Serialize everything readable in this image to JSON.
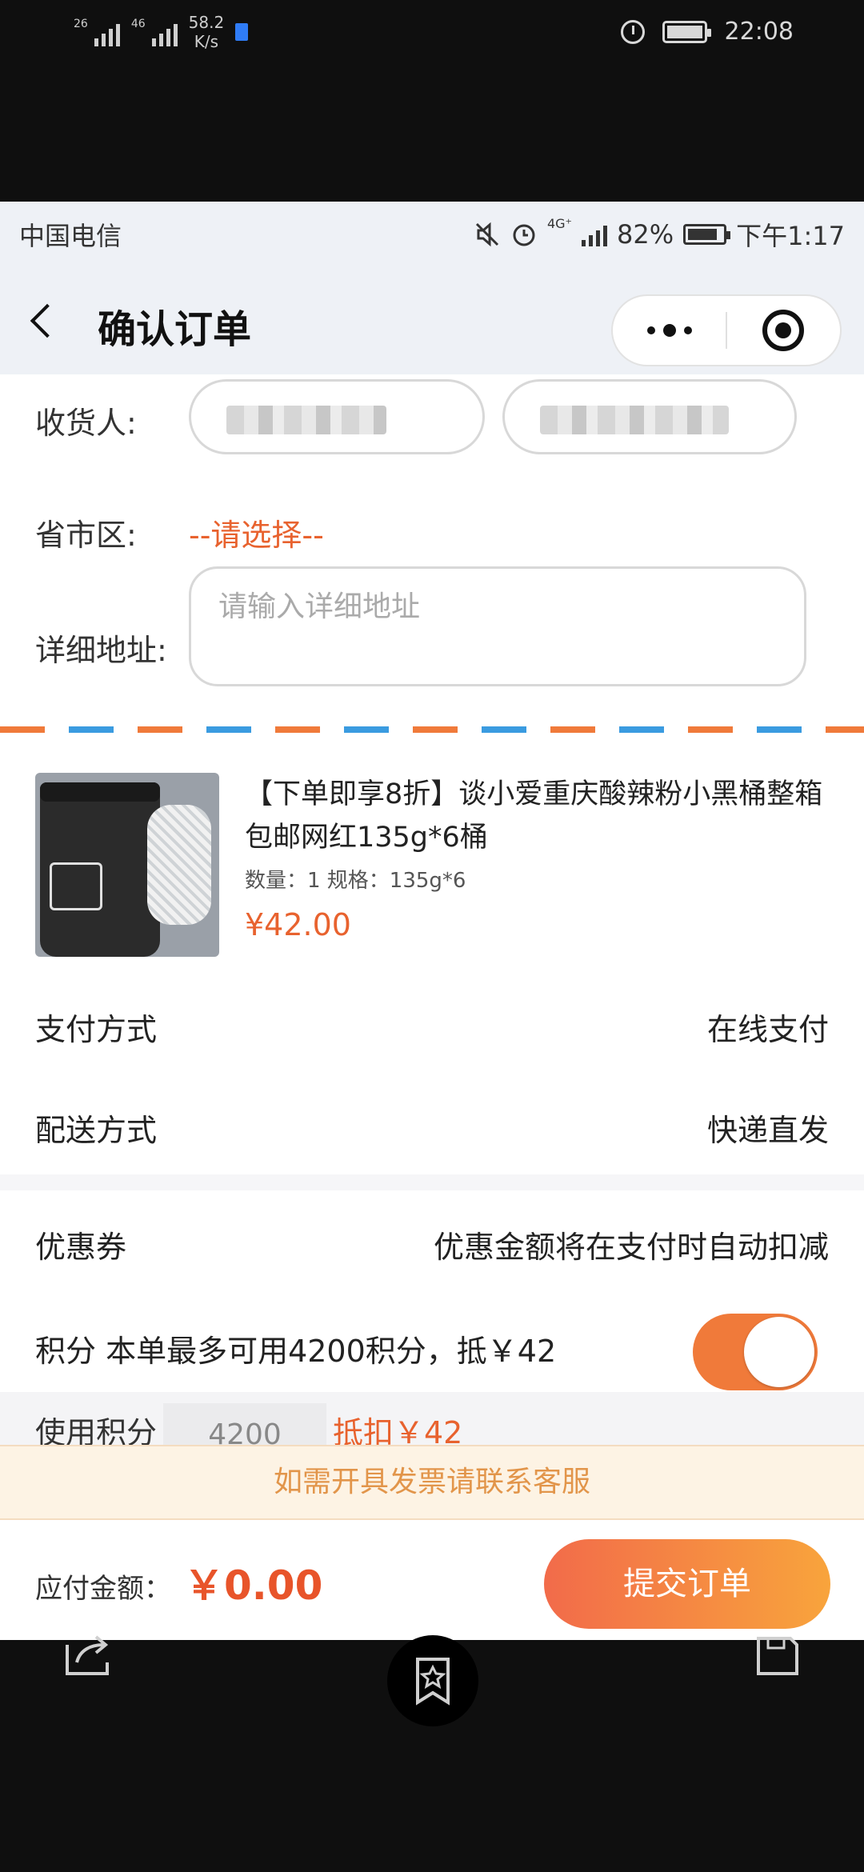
{
  "outer_status": {
    "signal_1": "26",
    "signal_2": "46",
    "speed": "58.2",
    "speed_unit": "K/s",
    "time": "22:08"
  },
  "inner_status": {
    "carrier": "中国电信",
    "network": "4G⁺",
    "battery": "82%",
    "time": "下午1:17"
  },
  "nav": {
    "title": "确认订单"
  },
  "address": {
    "receiver_label": "收货人:",
    "region_label": "省市区:",
    "region_value": "--请选择--",
    "detail_label": "详细地址:",
    "detail_placeholder": "请输入详细地址"
  },
  "product": {
    "title": "【下单即享8折】谈小爱重庆酸辣粉小黑桶整箱包邮网红135g*6桶",
    "spec": "数量：1 规格：135g*6",
    "price": "¥42.00"
  },
  "payment": {
    "label": "支付方式",
    "value": "在线支付"
  },
  "delivery": {
    "label": "配送方式",
    "value": "快递直发"
  },
  "coupon": {
    "label": "优惠券",
    "value": "优惠金额将在支付时自动扣减"
  },
  "points": {
    "label": "积分 本单最多可用4200积分，抵￥42",
    "enabled": true,
    "use_label": "使用积分",
    "use_value": "4200",
    "deduct_text": "抵扣￥42"
  },
  "invoice_notice": "如需开具发票请联系客服",
  "footer": {
    "amount_label": "应付金额：",
    "amount": "￥0.00",
    "submit": "提交订单"
  },
  "colors": {
    "accent_orange": "#e8622e",
    "submit_gradient_start": "#f26b4a",
    "submit_gradient_end": "#f8a43c",
    "toggle_on": "#f07a3a",
    "airmail_blue": "#3a9be0"
  }
}
